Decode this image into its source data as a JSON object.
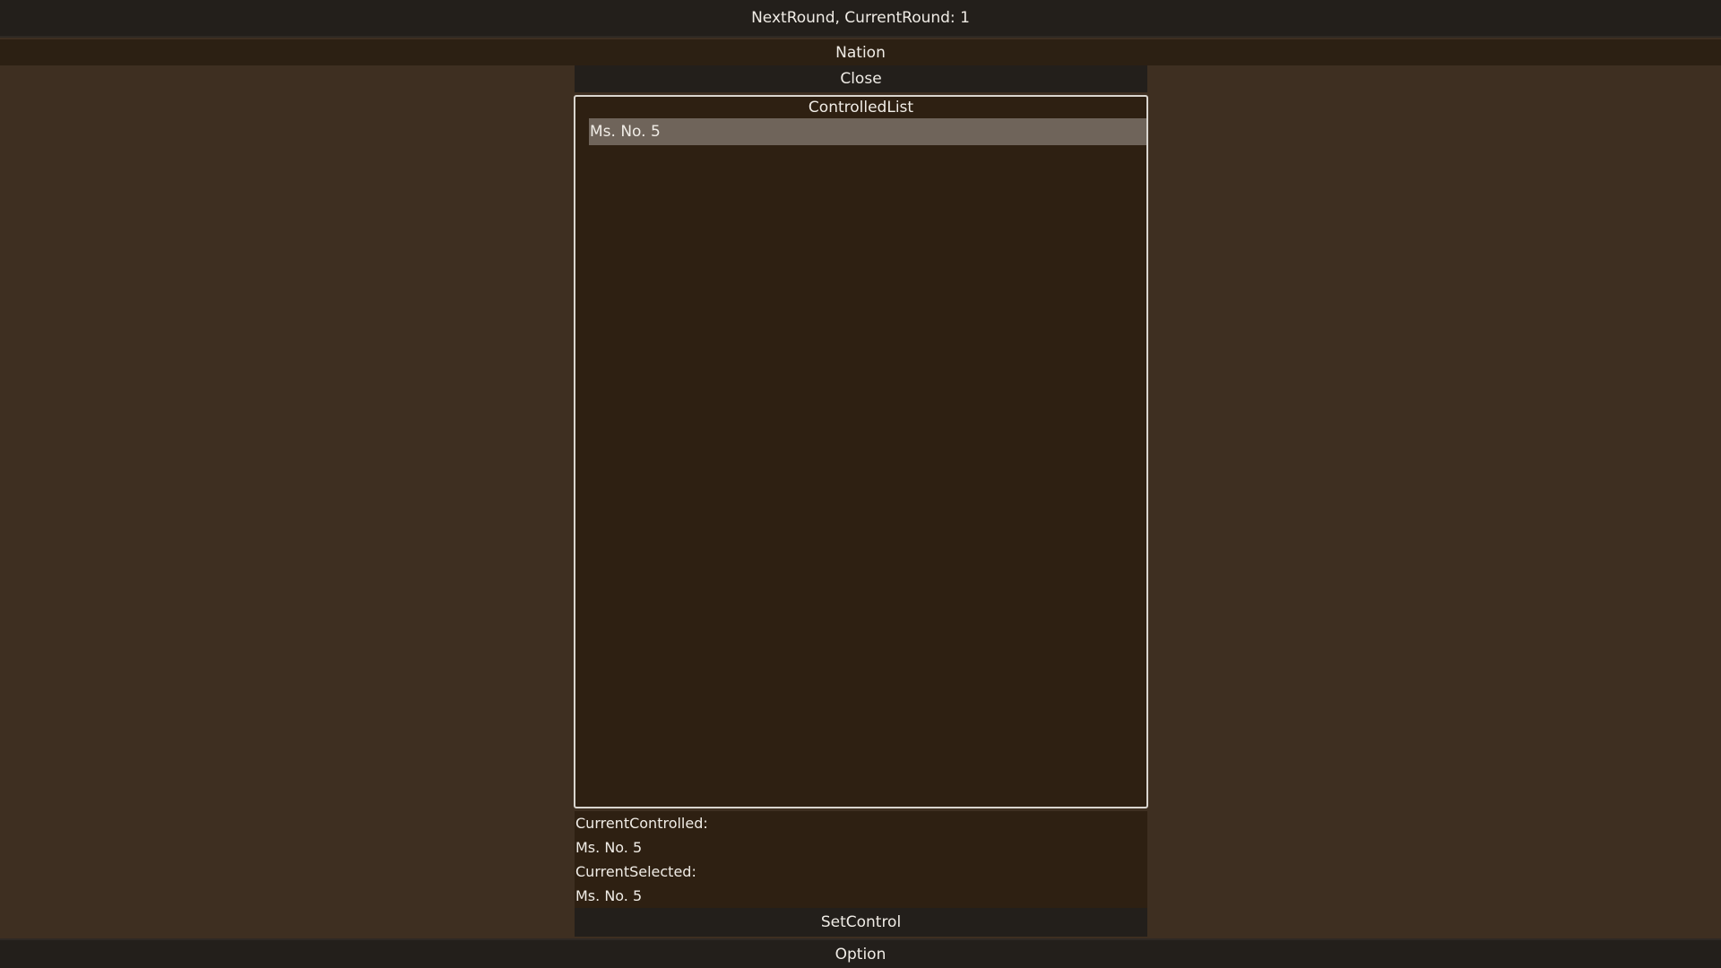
{
  "top_bar": {
    "next_round_label": "NextRound, CurrentRound: 1"
  },
  "nation_bar": {
    "title": "Nation"
  },
  "panel": {
    "close_label": "Close",
    "controlled_list": {
      "title": "ControlledList",
      "items": [
        {
          "label": "Ms. No. 5",
          "selected": true
        }
      ]
    },
    "info": {
      "current_controlled_label": "CurrentControlled:",
      "current_controlled_value": "Ms. No. 5",
      "current_selected_label": "CurrentSelected:",
      "current_selected_value": "Ms. No. 5"
    },
    "set_control_label": "SetControl"
  },
  "bottom_bar": {
    "option_label": "Option"
  },
  "colors": {
    "background": "#3e2f21",
    "bar": "#231f1b",
    "panel": "#2e2012",
    "selected_item": "#6f645a",
    "border": "#d9d5cf"
  }
}
